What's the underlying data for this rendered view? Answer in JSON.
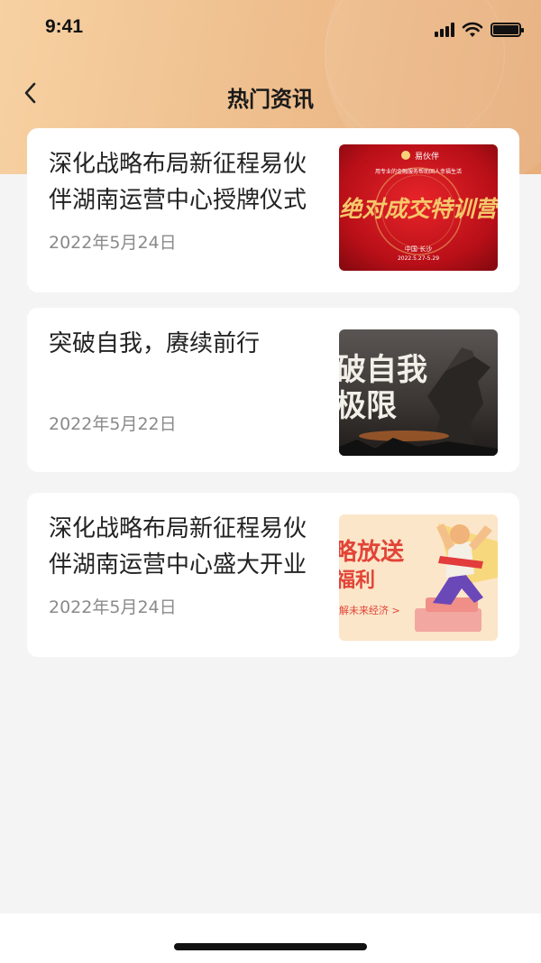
{
  "status_bar": {
    "time": "9:41"
  },
  "nav": {
    "title": "热门资讯"
  },
  "articles": [
    {
      "title": "深化战略布局新征程易伙伴湖南运营中心授牌仪式",
      "date": "2022年5月24日",
      "thumb_icon": "red-training-banner-image"
    },
    {
      "title": "突破自我，赓续前行",
      "date": "2022年5月22日",
      "thumb_icon": "dark-breakthrough-poster-image"
    },
    {
      "title": "深化战略布局新征程易伙伴湖南运营中心盛大开业",
      "date": "2022年5月24日",
      "thumb_icon": "welfare-promo-illustration-image"
    }
  ],
  "thumb_text": {
    "a1_brand": "易伙伴",
    "a1_slogan": "用专业的金融服务帮助国人幸福生活",
    "a1_headline": "绝对成交特训营",
    "a1_place": "中国·长沙",
    "a1_dates": "2022.5.27-5.29",
    "a2_line1": "破自我",
    "a2_line2": "极限",
    "a3_line1": "略放送",
    "a3_line2": "福利",
    "a3_line3": "解未来经济 >"
  },
  "colors": {
    "header_gradient_start": "#f7d1a2",
    "header_gradient_end": "#e7ad7a",
    "background": "#f4f4f4"
  }
}
